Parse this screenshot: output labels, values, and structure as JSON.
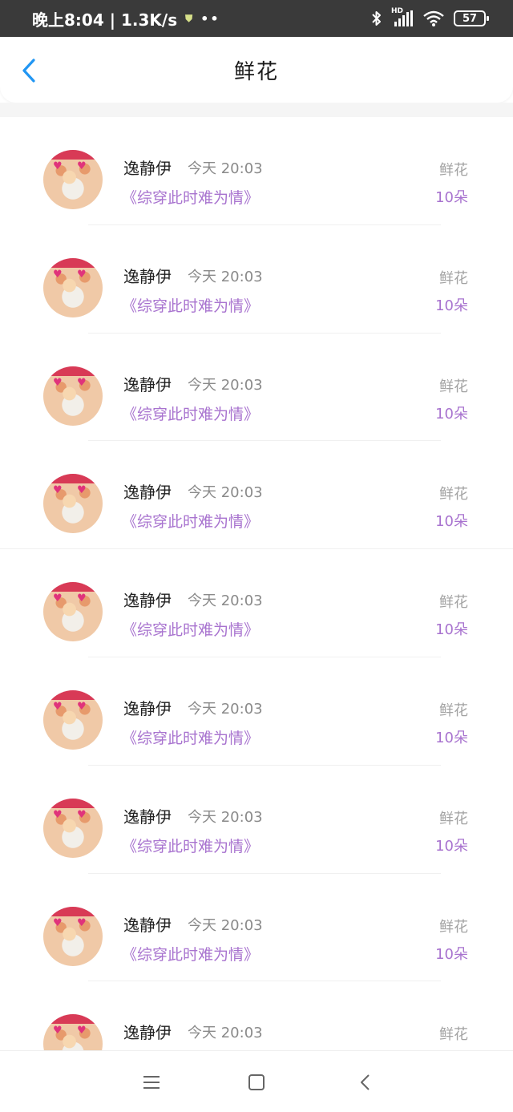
{
  "status_bar": {
    "time_speed": "晚上8:04 | 1.3K/s",
    "shield_icon": "shield-icon",
    "dots": "••",
    "network_label": "HD",
    "battery_level": "57"
  },
  "header": {
    "title": "鲜花",
    "back_icon": "chevron-left-icon"
  },
  "list": {
    "rows": [
      {
        "name": "逸静伊",
        "time": "今天 20:03",
        "book": "《综穿此时难为情》",
        "gift_type": "鲜花",
        "gift_count": "10朵"
      },
      {
        "name": "逸静伊",
        "time": "今天 20:03",
        "book": "《综穿此时难为情》",
        "gift_type": "鲜花",
        "gift_count": "10朵"
      },
      {
        "name": "逸静伊",
        "time": "今天 20:03",
        "book": "《综穿此时难为情》",
        "gift_type": "鲜花",
        "gift_count": "10朵"
      },
      {
        "name": "逸静伊",
        "time": "今天 20:03",
        "book": "《综穿此时难为情》",
        "gift_type": "鲜花",
        "gift_count": "10朵"
      },
      {
        "name": "逸静伊",
        "time": "今天 20:03",
        "book": "《综穿此时难为情》",
        "gift_type": "鲜花",
        "gift_count": "10朵"
      },
      {
        "name": "逸静伊",
        "time": "今天 20:03",
        "book": "《综穿此时难为情》",
        "gift_type": "鲜花",
        "gift_count": "10朵"
      },
      {
        "name": "逸静伊",
        "time": "今天 20:03",
        "book": "《综穿此时难为情》",
        "gift_type": "鲜花",
        "gift_count": "10朵"
      },
      {
        "name": "逸静伊",
        "time": "今天 20:03",
        "book": "《综穿此时难为情》",
        "gift_type": "鲜花",
        "gift_count": "10朵"
      },
      {
        "name": "逸静伊",
        "time": "今天 20:03",
        "book": "",
        "gift_type": "鲜花",
        "gift_count": ""
      }
    ]
  },
  "nav_bar": {
    "menu_icon": "menu-icon",
    "home_icon": "home-square-icon",
    "back_icon": "back-triangle-icon"
  },
  "colors": {
    "accent_blue": "#2196f3",
    "book_purple": "#a873cf",
    "muted_gray": "#a3a3a3",
    "status_bar_bg": "#3a3a3a"
  }
}
